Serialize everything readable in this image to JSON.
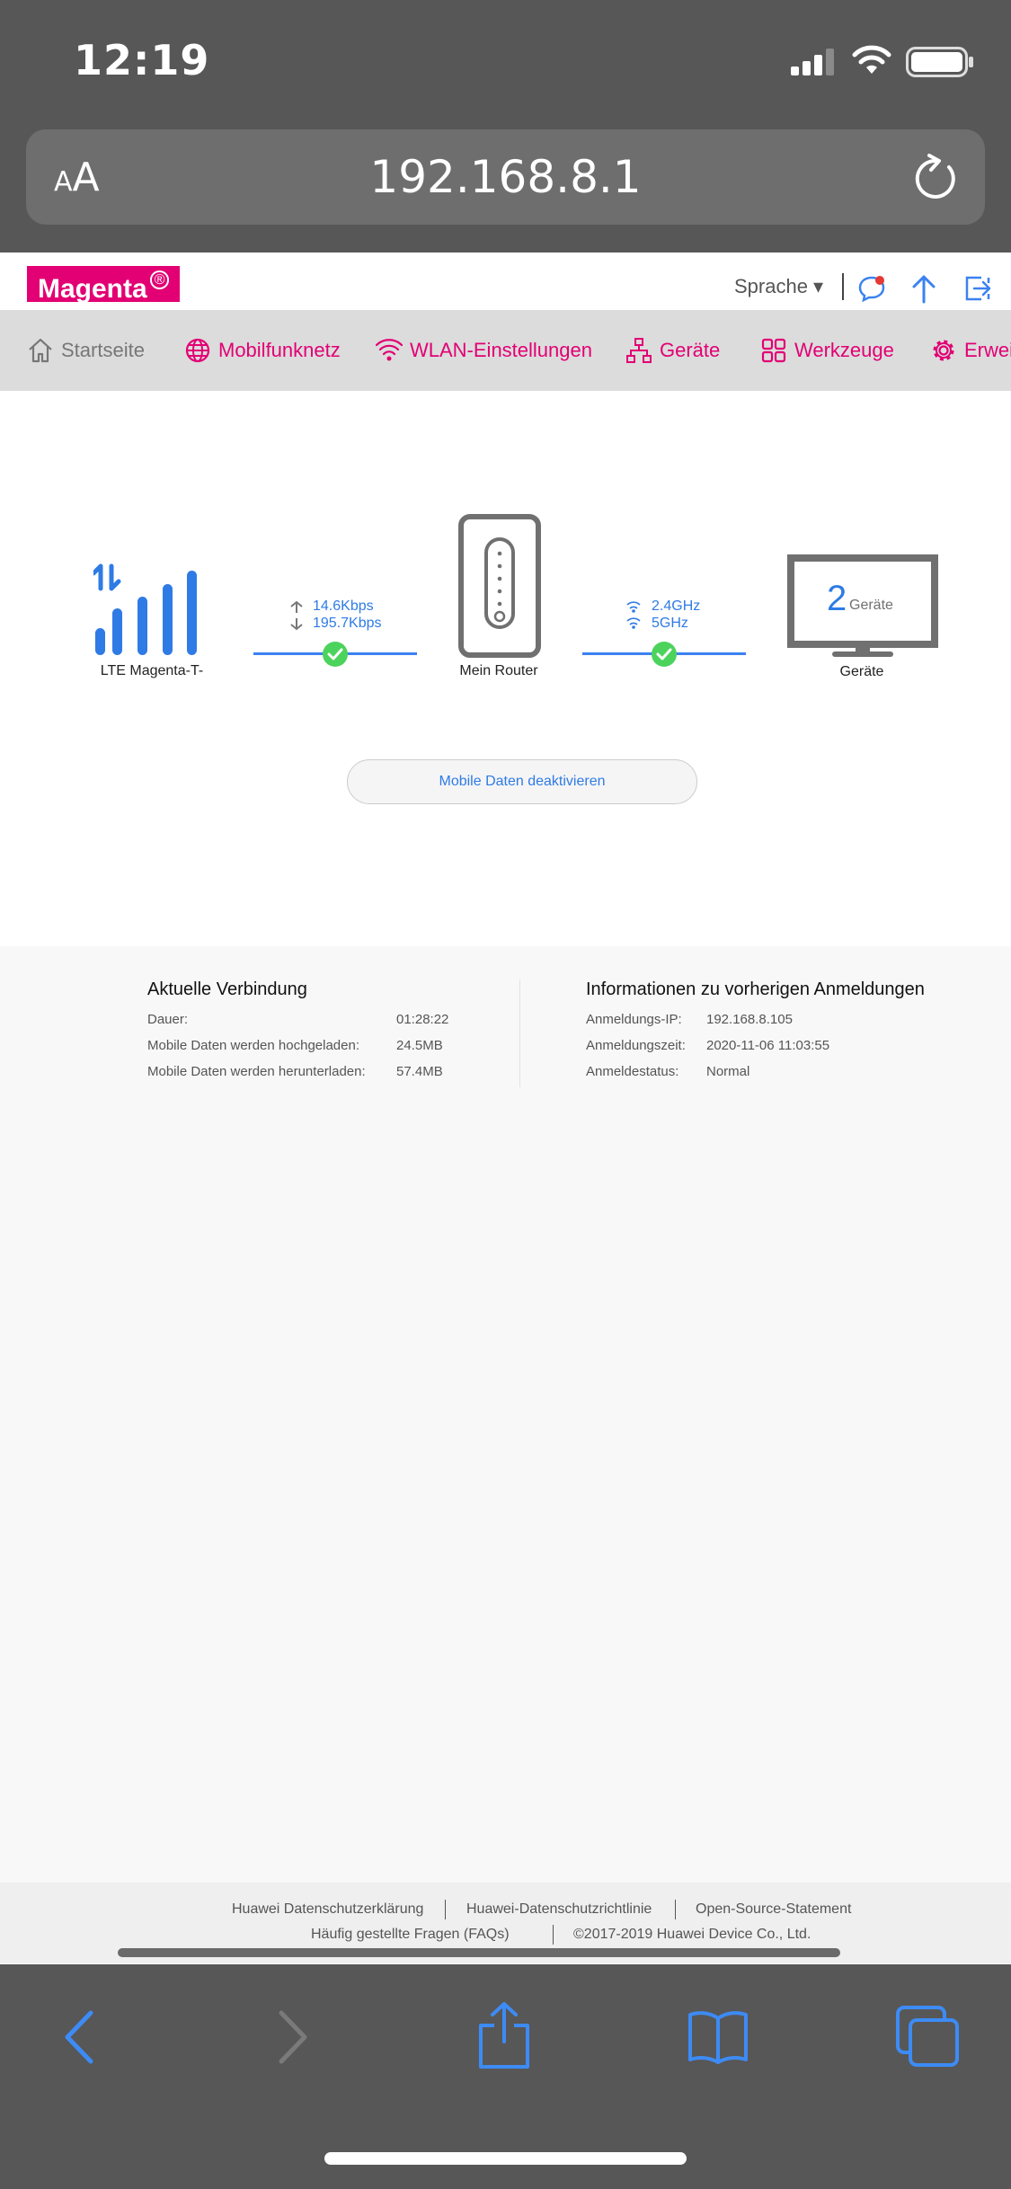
{
  "status_bar": {
    "time": "12:19"
  },
  "address_bar": {
    "text_size_small": "A",
    "text_size_large": "A",
    "url": "192.168.8.1"
  },
  "header": {
    "logo": "Magenta",
    "logo_mark": "®",
    "language": "Sprache ▾"
  },
  "nav": {
    "items": [
      {
        "label": "Startseite",
        "icon": "home-icon"
      },
      {
        "label": "Mobilfunknetz",
        "icon": "globe-icon"
      },
      {
        "label": "WLAN-Einstellungen",
        "icon": "wifi-icon"
      },
      {
        "label": "Geräte",
        "icon": "network-icon"
      },
      {
        "label": "Werkzeuge",
        "icon": "tools-icon"
      },
      {
        "label": "Erweit",
        "icon": "gear-icon"
      }
    ]
  },
  "dashboard": {
    "network_label": "LTE Magenta-T-",
    "upload_rate": "14.6Kbps",
    "download_rate": "195.7Kbps",
    "router_label": "Mein Router",
    "band_24": "2.4GHz",
    "band_5": "5GHz",
    "device_count": "2",
    "device_count_unit": "Geräte",
    "devices_label": "Geräte",
    "deactivate_button": "Mobile Daten deaktivieren"
  },
  "current_connection": {
    "title": "Aktuelle Verbindung",
    "rows": [
      {
        "key": "Dauer:",
        "value": "01:28:22"
      },
      {
        "key": "Mobile Daten werden hochgeladen:",
        "value": "24.5MB"
      },
      {
        "key": "Mobile Daten werden herunterladen:",
        "value": "57.4MB"
      }
    ]
  },
  "previous_logins": {
    "title": "Informationen zu vorherigen Anmeldungen",
    "rows": [
      {
        "key": "Anmeldungs-IP:",
        "value": "192.168.8.105"
      },
      {
        "key": "Anmeldungszeit:",
        "value": "2020-11-06 11:03:55"
      },
      {
        "key": "Anmeldestatus:",
        "value": "Normal"
      }
    ]
  },
  "footer": {
    "privacy_statement": "Huawei Datenschutzerklärung",
    "privacy_policy": "Huawei-Datenschutzrichtlinie",
    "open_source": "Open-Source-Statement",
    "faq": "Häufig gestellte Fragen (FAQs)",
    "copyright": "©2017-2019 Huawei Device Co., Ltd."
  },
  "colors": {
    "magenta": "#e20074",
    "blue": "#2f7be5",
    "green": "#4cd35c",
    "chrome": "#575757"
  }
}
